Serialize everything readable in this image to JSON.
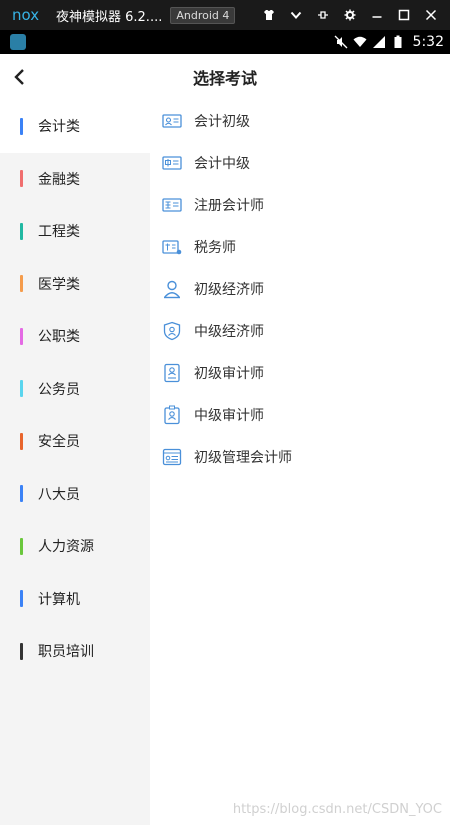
{
  "emulator": {
    "title": "夜神模拟器 6.2....",
    "android_badge": "Android 4",
    "controls": [
      "shirt-icon",
      "chevron-down-icon",
      "pin-icon",
      "gear-icon",
      "minimize-icon",
      "maximize-icon",
      "close-icon"
    ]
  },
  "status_bar": {
    "time": "5:32"
  },
  "header": {
    "title": "选择考试"
  },
  "categories": [
    {
      "label": "会计类",
      "color": "#3b82f6"
    },
    {
      "label": "金融类",
      "color": "#f06e6e"
    },
    {
      "label": "工程类",
      "color": "#21b8a2"
    },
    {
      "label": "医学类",
      "color": "#f59c4c"
    },
    {
      "label": "公职类",
      "color": "#e46ae4"
    },
    {
      "label": "公务员",
      "color": "#5ad5ee"
    },
    {
      "label": "安全员",
      "color": "#e8652c"
    },
    {
      "label": "八大员",
      "color": "#3b82f6"
    },
    {
      "label": "人力资源",
      "color": "#6ac73c"
    },
    {
      "label": "计算机",
      "color": "#3b82f6"
    },
    {
      "label": "职员培训",
      "color": "#333333"
    }
  ],
  "active_category": "会计类",
  "exams": [
    {
      "label": "会计初级",
      "icon": "id-card-icon"
    },
    {
      "label": "会计中级",
      "icon": "zhong-badge-icon"
    },
    {
      "label": "注册会计师",
      "icon": "zhu-badge-icon"
    },
    {
      "label": "税务师",
      "icon": "shui-badge-icon"
    },
    {
      "label": "初级经济师",
      "icon": "person-icon"
    },
    {
      "label": "中级经济师",
      "icon": "shield-user-icon"
    },
    {
      "label": "初级审计师",
      "icon": "document-user-icon"
    },
    {
      "label": "中级审计师",
      "icon": "badge-user-icon"
    },
    {
      "label": "初级管理会计师",
      "icon": "list-card-icon"
    }
  ],
  "accent_color": "#4a90d9",
  "watermark": "https://blog.csdn.net/CSDN_YOC"
}
